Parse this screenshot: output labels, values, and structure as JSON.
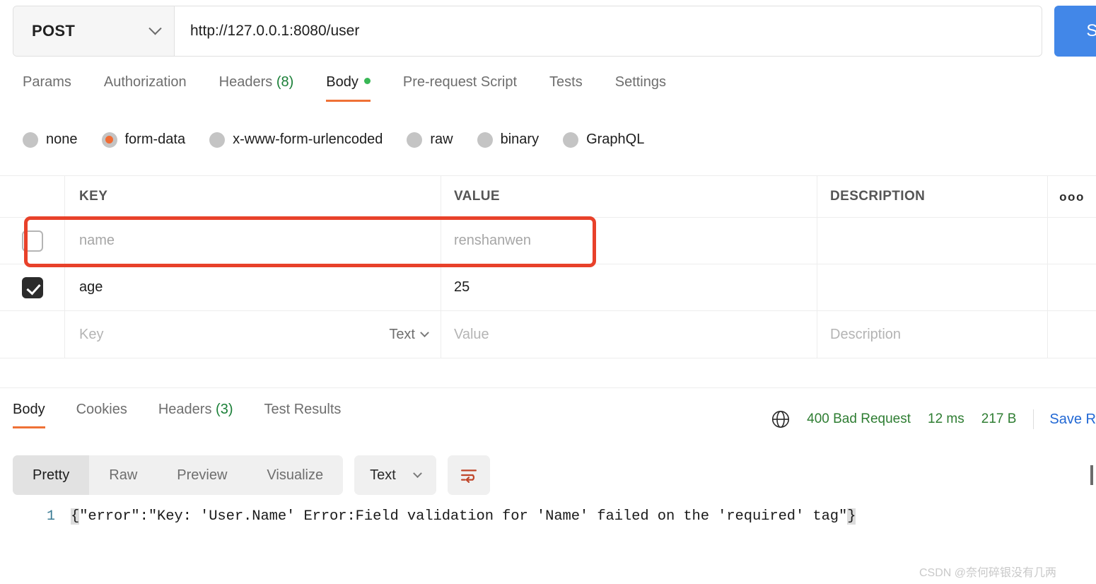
{
  "request": {
    "method": "POST",
    "method_caret_icon": "chevron-down-icon",
    "url": "http://127.0.0.1:8080/user",
    "send_label": "Se",
    "tabs": [
      {
        "label": "Params",
        "active": false
      },
      {
        "label": "Authorization",
        "active": false
      },
      {
        "label": "Headers",
        "count": "(8)",
        "active": false
      },
      {
        "label": "Body",
        "active": true,
        "dot": true
      },
      {
        "label": "Pre-request Script",
        "active": false
      },
      {
        "label": "Tests",
        "active": false
      },
      {
        "label": "Settings",
        "active": false
      }
    ],
    "body_types": [
      {
        "label": "none",
        "selected": false
      },
      {
        "label": "form-data",
        "selected": true
      },
      {
        "label": "x-www-form-urlencoded",
        "selected": false
      },
      {
        "label": "raw",
        "selected": false
      },
      {
        "label": "binary",
        "selected": false
      },
      {
        "label": "GraphQL",
        "selected": false
      }
    ]
  },
  "table": {
    "columns": {
      "key": "KEY",
      "value": "VALUE",
      "description": "DESCRIPTION",
      "more_icon": "ooo"
    },
    "rows": [
      {
        "checked": false,
        "key": "name",
        "value": "renshanwen",
        "description": "",
        "disabled": true
      },
      {
        "checked": true,
        "key": "age",
        "value": "25",
        "description": "",
        "disabled": false
      }
    ],
    "new_row": {
      "key_placeholder": "Key",
      "type_label": "Text",
      "value_placeholder": "Value",
      "description_placeholder": "Description"
    }
  },
  "annotation": {
    "color": "#e8412a",
    "target": "name-row"
  },
  "response": {
    "tabs": [
      {
        "label": "Body",
        "active": true
      },
      {
        "label": "Cookies",
        "active": false
      },
      {
        "label": "Headers",
        "count": "(3)",
        "active": false
      },
      {
        "label": "Test Results",
        "active": false
      }
    ],
    "globe_icon": "globe-icon",
    "status": "400 Bad Request",
    "time": "12 ms",
    "size": "217 B",
    "save_response_label": "Save R",
    "status_color": "#2e7d32",
    "format_tabs": [
      {
        "label": "Pretty",
        "active": true
      },
      {
        "label": "Raw",
        "active": false
      },
      {
        "label": "Preview",
        "active": false
      },
      {
        "label": "Visualize",
        "active": false
      }
    ],
    "format_type": "Text",
    "format_caret_icon": "chevron-down-icon",
    "wrap_icon": "wrap-text-icon",
    "code": {
      "line_number": "1",
      "open_brace": "{",
      "content": "\"error\":\"Key: 'User.Name' Error:Field validation for 'Name' failed on the 'required' tag\"",
      "close_brace": "}"
    }
  },
  "watermark": "CSDN @奈何碎银没有几两"
}
